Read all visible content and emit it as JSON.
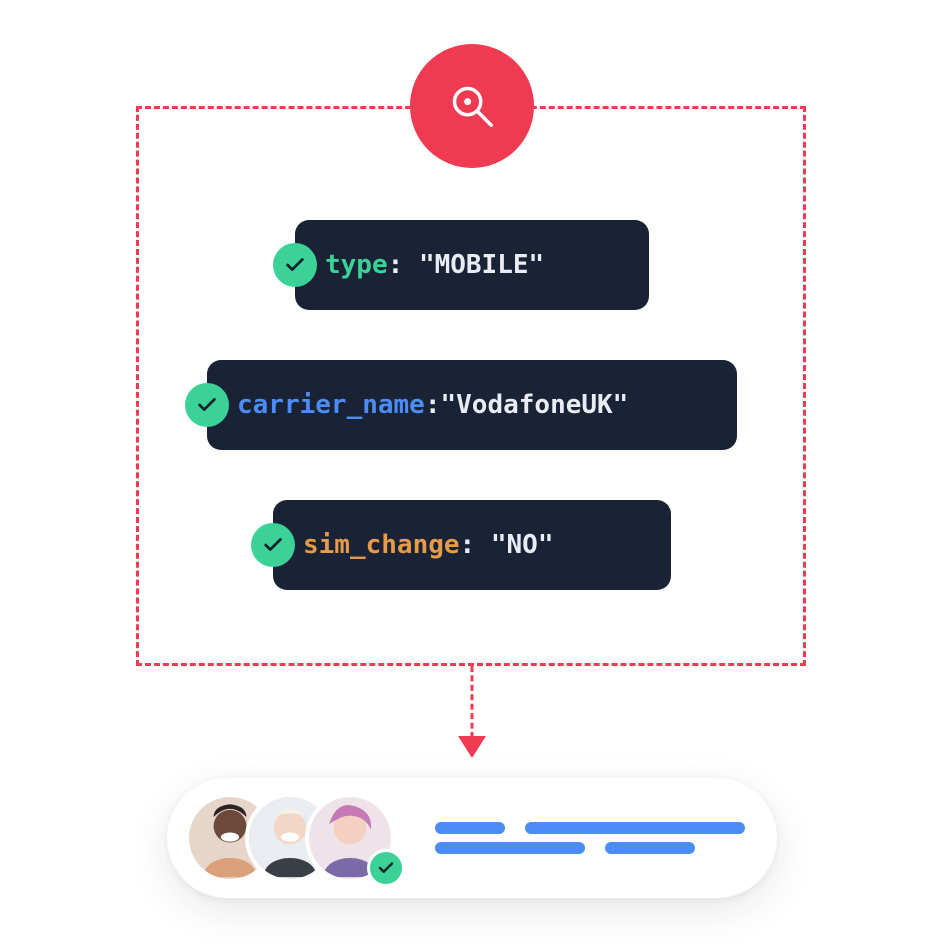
{
  "colors": {
    "red": "#ef3a51",
    "dark": "#1a2335",
    "green_check": "#3bd197",
    "key_green": "#3bd197",
    "key_blue": "#4b8cf7",
    "key_orange": "#e69a4a",
    "value_white": "#e9ecf3",
    "line_blue": "#4b8cf7",
    "check_stroke": "#14222e"
  },
  "attributes": [
    {
      "key": "type",
      "sep": ": ",
      "value": "\"MOBILE\"",
      "key_color": "key_green"
    },
    {
      "key": "carrier_name",
      "sep": ":",
      "value": "\"VodafoneUK\"",
      "key_color": "key_blue"
    },
    {
      "key": "sim_change",
      "sep": ": ",
      "value": "\"NO\"",
      "key_color": "key_orange"
    }
  ],
  "result": {
    "avatar_count": 3,
    "verified": true,
    "line_rows": [
      {
        "widths": [
          70,
          220
        ]
      },
      {
        "widths": [
          150,
          90
        ]
      }
    ]
  }
}
